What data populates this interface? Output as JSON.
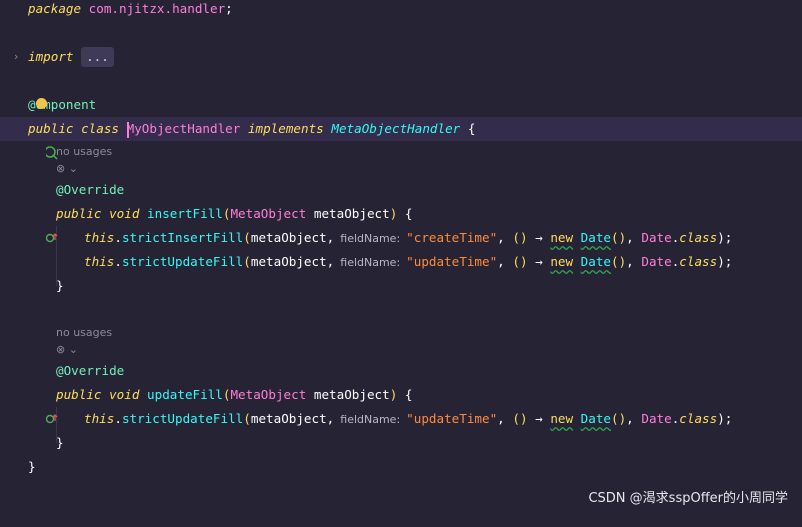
{
  "lines": {
    "l1": {
      "kw": "package",
      "pkg": "com.njitzx.handler",
      "semi": ";"
    },
    "l3": {
      "kw": "import",
      "ellipsis": "..."
    },
    "l5": {
      "at": "@",
      "rest": "omponent"
    },
    "l6": {
      "public": "public",
      "class": "class",
      "name": "MyObjectHandler",
      "implements": "implements",
      "iface": "MetaObjectHandler",
      "brace": "{"
    },
    "l7": {
      "hint": "no usages"
    },
    "l8": {
      "hint": "⊗ ⌄"
    },
    "l9": {
      "ann": "@Override"
    },
    "l10": {
      "public": "public",
      "void": "void",
      "fn": "insertFill",
      "lp": "(",
      "type": "MetaObject",
      "param": "metaObject",
      "rp": ")",
      "brace": "{"
    },
    "l11": {
      "this": "this",
      "dot": ".",
      "method": "strictInsertFill",
      "lp": "(",
      "arg": "metaObject,",
      "pname": "fieldName:",
      "str": "\"createTime\"",
      "comma": ",",
      "lambda": "()",
      "arrow": "→",
      "new": "new",
      "date": "Date",
      "dateparens": "()",
      "comma2": ",",
      "dtype": "Date",
      "dot2": ".",
      "classkw": "class",
      "end": ");"
    },
    "l12": {
      "this": "this",
      "dot": ".",
      "method": "strictUpdateFill",
      "lp": "(",
      "arg": "metaObject,",
      "pname": "fieldName:",
      "str": "\"updateTime\"",
      "comma": ",",
      "lambda": "()",
      "arrow": "→",
      "new": "new",
      "date": "Date",
      "dateparens": "()",
      "comma2": ",",
      "dtype": "Date",
      "dot2": ".",
      "classkw": "class",
      "end": ");"
    },
    "l13": {
      "brace": "}"
    },
    "l15": {
      "hint": "no usages"
    },
    "l16": {
      "hint": "⊗ ⌄"
    },
    "l17": {
      "ann": "@Override"
    },
    "l18": {
      "public": "public",
      "void": "void",
      "fn": "updateFill",
      "lp": "(",
      "type": "MetaObject",
      "param": "metaObject",
      "rp": ")",
      "brace": "{"
    },
    "l19": {
      "this": "this",
      "dot": ".",
      "method": "strictUpdateFill",
      "lp": "(",
      "arg": "metaObject,",
      "pname": "fieldName:",
      "str": "\"updateTime\"",
      "comma": ",",
      "lambda": "()",
      "arrow": "→",
      "new": "new",
      "date": "Date",
      "dateparens": "()",
      "comma2": ",",
      "dtype": "Date",
      "dot2": ".",
      "classkw": "class",
      "end": ");"
    },
    "l20": {
      "brace": "}"
    },
    "l21": {
      "brace": "}"
    }
  },
  "watermark": "CSDN @渴求sspOffer的小周同学"
}
